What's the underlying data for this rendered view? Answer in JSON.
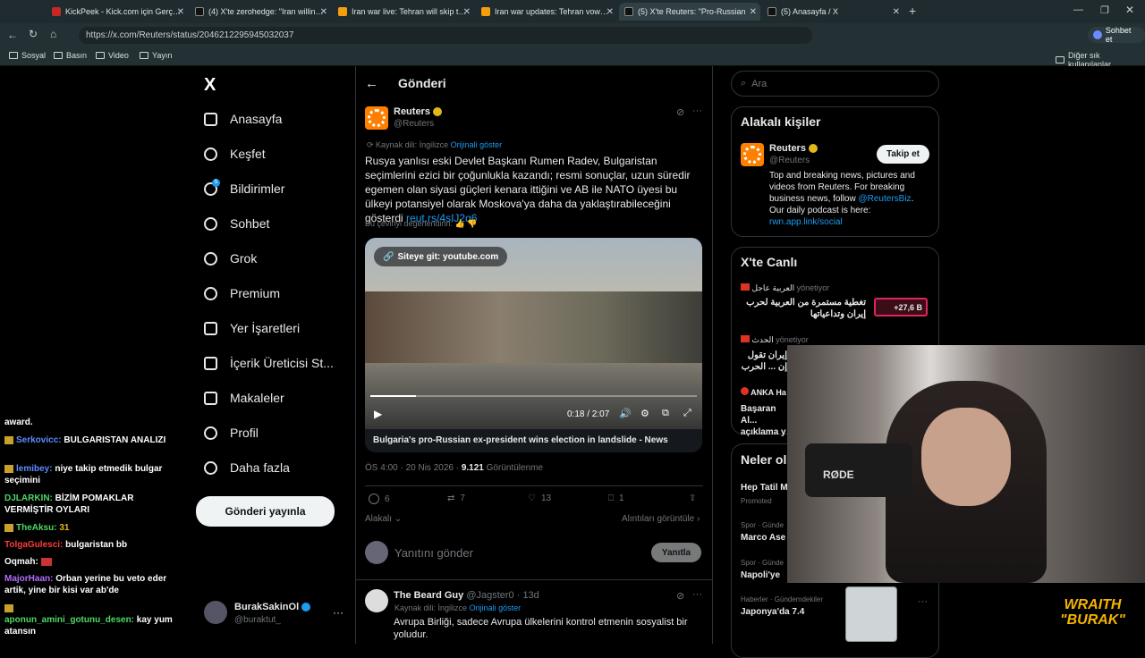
{
  "browser": {
    "tabs": [
      {
        "label": "KickPeek - Kick.com için Gerçek Za",
        "color": "#c62828"
      },
      {
        "label": "(4) X'te zerohedge: \"Iran willing to",
        "color": "#111"
      },
      {
        "label": "Iran war live: Tehran will skip talks",
        "color": "#f59e0b"
      },
      {
        "label": "Iran war updates: Tehran vows resp",
        "color": "#f59e0b"
      },
      {
        "label": "(5) X'te Reuters: \"Pro-Russian",
        "color": "#111"
      },
      {
        "label": "(5) Anasayfa / X",
        "color": "#111"
      }
    ],
    "url": "https://x.com/Reuters/status/2046212295945032037",
    "bookmarks": [
      "Sosyal",
      "Basın",
      "Video",
      "Yayın"
    ],
    "other_bookmarks": "Diğer sık kullanılanlar",
    "chat_button": "Sohbet et"
  },
  "sidebar": {
    "items": [
      {
        "label": "Anasayfa",
        "icon": "home-icon"
      },
      {
        "label": "Keşfet",
        "icon": "search-icon"
      },
      {
        "label": "Bildirimler",
        "icon": "bell-icon",
        "badge": "5"
      },
      {
        "label": "Sohbet",
        "icon": "chat-icon"
      },
      {
        "label": "Grok",
        "icon": "grok-icon"
      },
      {
        "label": "Premium",
        "icon": "premium-icon"
      },
      {
        "label": "Yer İşaretleri",
        "icon": "bookmark-icon"
      },
      {
        "label": "İçerik Üreticisi St...",
        "icon": "rocket-icon"
      },
      {
        "label": "Makaleler",
        "icon": "article-icon"
      },
      {
        "label": "Profil",
        "icon": "profile-icon"
      },
      {
        "label": "Daha fazla",
        "icon": "more-icon"
      }
    ],
    "post_button": "Gönderi yayınla",
    "account": {
      "name": "BurakSakinOl",
      "handle": "@buraktut_"
    }
  },
  "chat": [
    {
      "user": "",
      "msg": "award."
    },
    {
      "user": "Serkovicc:",
      "msg": "BULGARISTAN ANALIZI",
      "color": "#5b8cff"
    },
    {
      "user": "lemibey:",
      "msg": "niye takip etmedik bulgar seçimini",
      "color": "#5b8cff"
    },
    {
      "user": "DJLARKIN:",
      "msg": "BİZİM POMAKLAR VERMİŞTİR OYLARI",
      "color": "#4cd964"
    },
    {
      "user": "TheAksu:",
      "msg": "31",
      "color": "#4cd964"
    },
    {
      "user": "TolgaGulesci:",
      "msg": "bulgaristan bb",
      "color": "#ff3b3b"
    },
    {
      "user": "Oqmah:",
      "msg": "",
      "color": "#ffffff"
    },
    {
      "user": "MajorHaan:",
      "msg": "Orban yerine bu veto eder artik, yine bir kisi var ab'de",
      "color": "#b56cff"
    },
    {
      "user": "aponun_amini_gotunu_desen:",
      "msg": "kay yum atansın",
      "color": "#4cd964"
    }
  ],
  "post": {
    "header": "Gönderi",
    "author": "Reuters",
    "handle": "@Reuters",
    "source_lang": "Kaynak dili: İngilizce",
    "show_original": "Orijinali göster",
    "text": "Rusya yanlısı eski Devlet Başkanı Rumen Radev, Bulgaristan seçimlerini ezici bir çoğunlukla kazandı; resmi sonuçlar, uzun süredir egemen olan siyasi güçleri kenara ittiğini ve AB ile NATO üyesi bu ülkeyi potansiyel olarak Moskova'ya daha da yaklaştırabileceğini gösterdi",
    "link": "reut.rs/4sIJ2q6",
    "rate_translation": "Bu çeviriyi değerlendirin:",
    "video": {
      "site_button": "Siteye git: youtube.com",
      "time": "0:18 / 2:07",
      "caption": "Bulgaria's pro-Russian ex-president wins election in landslide - News",
      "progress": 0.14
    },
    "meta_time": "ÖS 4:00 · 20 Nis 2026 ·",
    "views": "9.121",
    "views_label": "Görüntülenme",
    "stats": {
      "replies": "6",
      "reposts": "7",
      "likes": "13",
      "bookmarks": "1"
    },
    "relevant": "Alakalı",
    "quotes": "Alıntıları görüntüle",
    "reply_placeholder": "Yanıtını gönder",
    "reply_button": "Yanıtla"
  },
  "reply": {
    "author": "The Beard Guy",
    "handle": "@Jagster0 · 13d",
    "source_lang": "Kaynak dili: İngilizce",
    "show_original": "Orijinali göster",
    "text": "Avrupa Birliği, sadece Avrupa ülkelerini kontrol etmenin sosyalist bir yoludur."
  },
  "right": {
    "search_placeholder": "Ara",
    "relevant_title": "Alakalı kişiler",
    "person": {
      "name": "Reuters",
      "handle": "@Reuters",
      "follow": "Takip et",
      "bio": "Top and breaking news, pictures and videos from Reuters. For breaking business news, follow",
      "bio_link": "@ReutersBiz",
      "bio_end": "Our daily podcast is here:",
      "bio_url": "rwn.app.link/social"
    },
    "live_title": "X'te Canlı",
    "live1": {
      "channel": "العربية عاجل",
      "role": "yönetiyor",
      "title": "تغطية مستمرة من العربية لحرب إيران وتداعياتها",
      "count": "+27,6 B"
    },
    "live2": {
      "channel": "الحدث",
      "role": "yönetiyor",
      "title": "إيران تقول إن ... الحرب \"غير"
    },
    "live3": {
      "channel": "ANKA Ha",
      "title": "Başaran Al... açıklama y"
    },
    "trends_title": "Neler ol",
    "trends": [
      {
        "meta": "",
        "name": "Hep Tatil M",
        "promo": "Promoted"
      },
      {
        "meta": "Spor · Günde",
        "name": "Marco Ase"
      },
      {
        "meta": "Spor · Günde",
        "name": "Napoli'ye"
      },
      {
        "meta": "Haberler · Gündemdekiler",
        "name": "Japonya'da 7.4"
      }
    ]
  },
  "overlay": {
    "brand1": "WRAITH",
    "brand2": "\"BURAK\"",
    "mic": "RØDE"
  }
}
